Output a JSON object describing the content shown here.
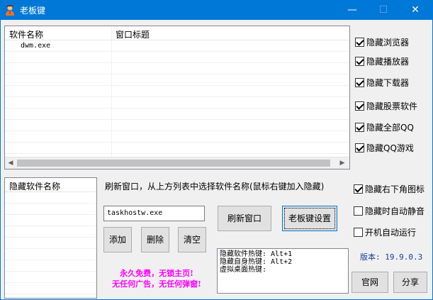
{
  "window": {
    "title": "老板键"
  },
  "process_list": {
    "columns": [
      "软件名称",
      "窗口标题"
    ],
    "rows": [
      {
        "name": "dwm.exe",
        "title": ""
      }
    ]
  },
  "right_checks": [
    {
      "label": "隐藏浏览器",
      "checked": true
    },
    {
      "label": "隐藏播放器",
      "checked": true
    },
    {
      "label": "隐藏下载器",
      "checked": true
    },
    {
      "label": "隐藏股票软件",
      "checked": true
    },
    {
      "label": "隐藏全部QQ",
      "checked": true
    },
    {
      "label": "隐藏QQ游戏",
      "checked": true
    }
  ],
  "option_checks": [
    {
      "label": "隐藏右下角图标",
      "checked": true
    },
    {
      "label": "隐藏时自动静音",
      "checked": false
    },
    {
      "label": "开机自动运行",
      "checked": false
    }
  ],
  "hidden_list": {
    "header": "隐藏软件名称"
  },
  "hint": "刷新窗口，从上方列表中选择软件名称(鼠标右键加入隐藏)",
  "input": {
    "value": "taskhostw.exe"
  },
  "buttons": {
    "refresh": "刷新窗口",
    "settings": "老板键设置",
    "add": "添加",
    "delete": "删除",
    "clear": "清空",
    "website": "官网",
    "share": "分享"
  },
  "hotkeys": {
    "line1": "隐藏软件热键: Alt+1",
    "line2": "隐藏自身热键: Alt+2",
    "line3": "虚拟桌面热键:"
  },
  "promo": {
    "line1": "永久免费，无锁主页!",
    "line2": "无任何广告，无任何弹窗!"
  },
  "version": "版本: 19.9.0.3",
  "colors": {
    "titlebar": "#0078d7",
    "promo": "#ff00ff",
    "version": "#1a3a9e"
  }
}
